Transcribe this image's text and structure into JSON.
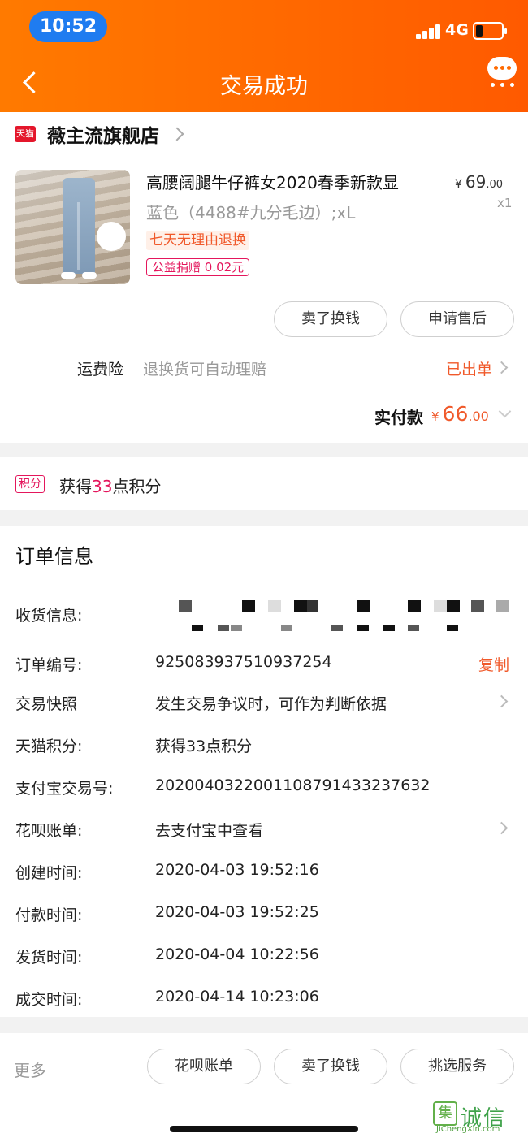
{
  "status_bar": {
    "time": "10:52",
    "network": "4G",
    "battery_level": 0.25
  },
  "header": {
    "title": "交易成功"
  },
  "store": {
    "badge": "天猫",
    "name": "薇主流旗舰店"
  },
  "product": {
    "title": "高腰阔腿牛仔裤女2020春季新款显",
    "price_yen": "¥",
    "price_int": "69",
    "price_dec": ".00",
    "sku": "蓝色（4488#九分毛边）;xL",
    "qty": "x1",
    "tag_return": "七天无理由退换",
    "tag_charity": "公益捐赠 0.02元"
  },
  "actions": {
    "sell_for_cash": "卖了换钱",
    "after_sales": "申请售后"
  },
  "shipping_insurance": {
    "label": "运费险",
    "desc": "退换货可自动理赔",
    "status": "已出单"
  },
  "payment": {
    "label": "实付款",
    "yen": "¥",
    "amount_int": "66",
    "amount_dec": ".00"
  },
  "points": {
    "badge": "积分",
    "prefix": "获得",
    "value": "33",
    "suffix": "点积分"
  },
  "order_info": {
    "title": "订单信息",
    "shipping_label": "收货信息:",
    "rows": [
      {
        "label": "订单编号:",
        "value": "925083937510937254",
        "action": "复制"
      },
      {
        "label": "交易快照",
        "value": "发生交易争议时，可作为判断依据"
      },
      {
        "label": "天猫积分:",
        "value": "获得33点积分"
      },
      {
        "label": "支付宝交易号:",
        "value": "2020040322001108791433237632"
      },
      {
        "label": "花呗账单:",
        "value": "去支付宝中查看"
      },
      {
        "label": "创建时间:",
        "value": "2020-04-03 19:52:16"
      },
      {
        "label": "付款时间:",
        "value": "2020-04-03 19:52:25"
      },
      {
        "label": "发货时间:",
        "value": "2020-04-04 10:22:56"
      },
      {
        "label": "成交时间:",
        "value": "2020-04-14 10:23:06"
      }
    ]
  },
  "bottom_bar": {
    "more": "更多",
    "huabei_bill": "花呗账单",
    "sell_for_cash": "卖了换钱",
    "pick_service": "挑选服务"
  },
  "watermark": {
    "logo": "集",
    "text": "诚信",
    "sub": "JiChengXin.com"
  },
  "colors": {
    "header_orange": "#ff6a00",
    "accent_orange": "#f0592a",
    "tmall_red": "#e4162b",
    "points_pink": "#e4165c"
  }
}
